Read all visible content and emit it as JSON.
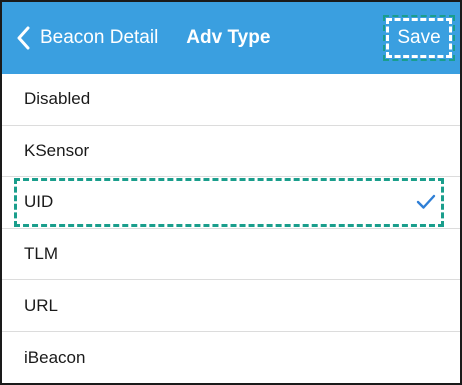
{
  "navbar": {
    "back_label": "Beacon Detail",
    "title": "Adv Type",
    "save_label": "Save",
    "background_color": "#3a9fe0"
  },
  "list": {
    "items": [
      {
        "label": "Disabled",
        "selected": false
      },
      {
        "label": "KSensor",
        "selected": false
      },
      {
        "label": "UID",
        "selected": true
      },
      {
        "label": "TLM",
        "selected": false
      },
      {
        "label": "URL",
        "selected": false
      },
      {
        "label": "iBeacon",
        "selected": false
      }
    ],
    "check_icon": "checkmark-icon",
    "check_color": "#2f7fd6",
    "highlight_color": "#1a9e8c"
  }
}
